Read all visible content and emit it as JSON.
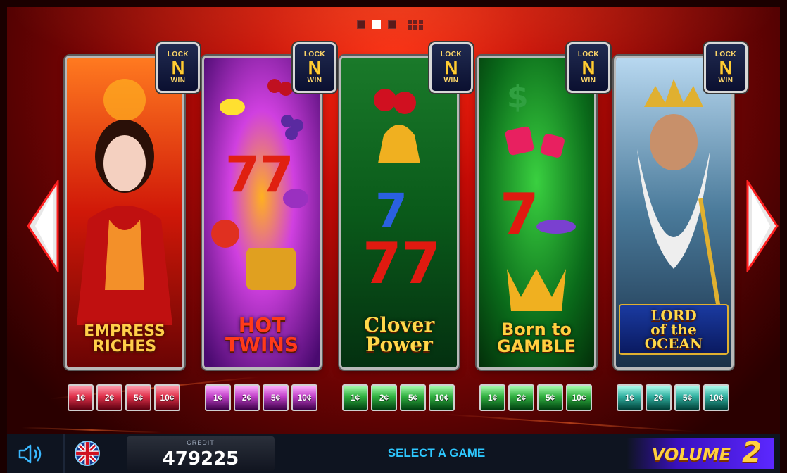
{
  "pager": {
    "count": 3,
    "active_index": 1
  },
  "games": [
    {
      "title": "EMPRESS\nRICHES",
      "theme": "red",
      "badge": {
        "top": "LOCK",
        "mid": "N",
        "bottom": "WIN"
      },
      "denoms": [
        "1¢",
        "2¢",
        "5¢",
        "10¢"
      ],
      "title_color": "#ffcf4a"
    },
    {
      "title": "HOT\nTWINS",
      "theme": "purple",
      "badge": {
        "top": "LOCK",
        "mid": "N",
        "bottom": "WIN"
      },
      "denoms": [
        "1¢",
        "2¢",
        "5¢",
        "10¢"
      ],
      "title_color": "#ff3a1a"
    },
    {
      "title": "Clover\nPower",
      "theme": "green",
      "badge": {
        "top": "LOCK",
        "mid": "N",
        "bottom": "WIN"
      },
      "denoms": [
        "1¢",
        "2¢",
        "5¢",
        "10¢"
      ],
      "title_color": "#ffd84a"
    },
    {
      "title": "Born to\nGAMBLE",
      "theme": "green",
      "badge": {
        "top": "LOCK",
        "mid": "N",
        "bottom": "WIN"
      },
      "denoms": [
        "1¢",
        "2¢",
        "5¢",
        "10¢"
      ],
      "title_color": "#ffd040"
    },
    {
      "title": "LORD\nof the\nOCEAN",
      "theme": "teal",
      "badge": {
        "top": "LOCK",
        "mid": "N",
        "bottom": "WIN"
      },
      "denoms": [
        "1¢",
        "2¢",
        "5¢",
        "10¢"
      ],
      "title_color": "#ffd84a"
    }
  ],
  "bottom_bar": {
    "credit_label": "CREDIT",
    "credit_value": "479225",
    "status_text": "SELECT A GAME",
    "volume_label": "VOLUME",
    "volume_number": "2"
  },
  "icons": {
    "sound": "speaker-icon",
    "language": "uk-flag-icon",
    "left": "arrow-left-icon",
    "right": "arrow-right-icon"
  }
}
